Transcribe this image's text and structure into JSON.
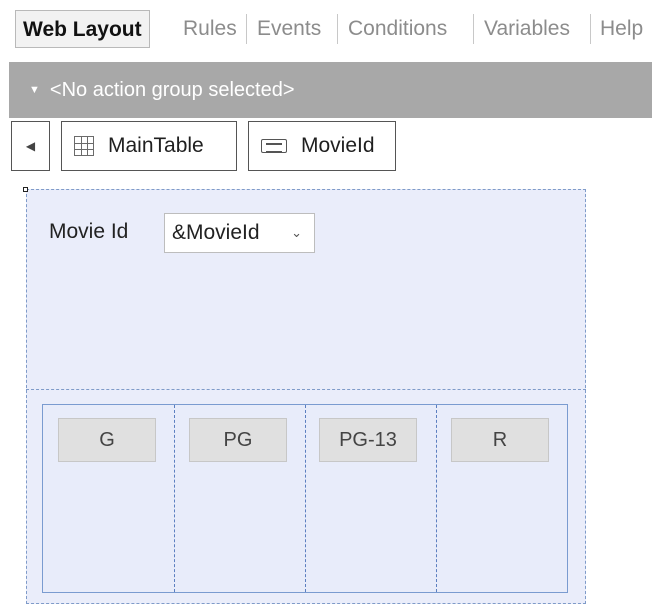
{
  "tabs": [
    {
      "label": "Web Layout",
      "active": true
    },
    {
      "label": "Rules"
    },
    {
      "label": "Events"
    },
    {
      "label": "Conditions"
    },
    {
      "label": "Variables"
    },
    {
      "label": "Help"
    }
  ],
  "action_bar": {
    "label": "<No action group selected>",
    "caret": "▼"
  },
  "breadcrumb": {
    "back_glyph": "◀",
    "items": [
      {
        "label": "MainTable",
        "icon": "table-grid-icon"
      },
      {
        "label": "MovieId",
        "icon": "variable-attribute-icon"
      }
    ]
  },
  "form": {
    "field_label": "Movie Id",
    "combo_value": "&MovieId",
    "combo_chevron": "⌄"
  },
  "rating_buttons": [
    {
      "label": "G"
    },
    {
      "label": "PG"
    },
    {
      "label": "PG-13"
    },
    {
      "label": "R"
    }
  ],
  "colors": {
    "action_bar": "#a8a8a8",
    "canvas_bg": "#eaedfa",
    "canvas_border": "#7f9bc9",
    "button_bg": "#e0e0e0"
  }
}
